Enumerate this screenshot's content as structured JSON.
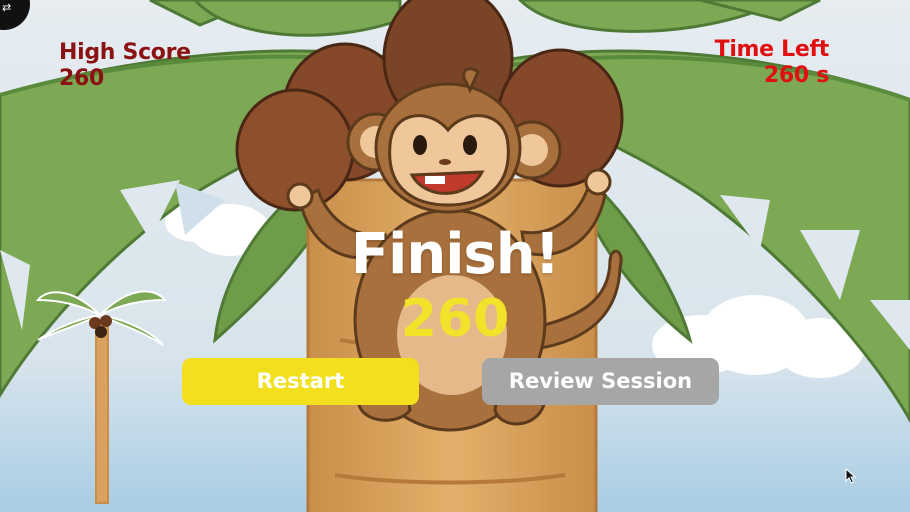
{
  "hud": {
    "high_score_label": "High Score",
    "high_score_value": "260",
    "time_left_label": "Time Left",
    "time_left_value": "260 s"
  },
  "result": {
    "title": "Finish!",
    "score": "260"
  },
  "buttons": {
    "restart_label": "Restart",
    "review_label": "Review Session"
  },
  "corner_button": {
    "icon": "swap-arrows-icon",
    "glyph": "⇄"
  },
  "colors": {
    "sky": "#dfe8ee",
    "leaf": "#7da955",
    "leaf_dark": "#4f7a36",
    "trunk": "#d9a25f",
    "monkey": "#a8703c",
    "coconut": "#7a4426",
    "high_score_text": "#8b1212",
    "time_left_text": "#e01010",
    "score_yellow": "#f3e22a",
    "restart_bg": "#f2df1d",
    "review_bg": "#a6a6a6"
  }
}
